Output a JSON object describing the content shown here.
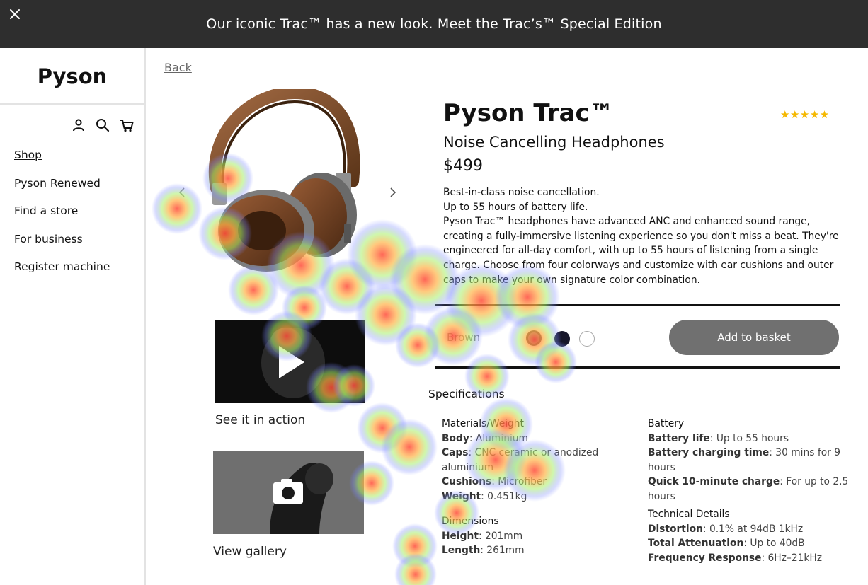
{
  "banner": {
    "close_icon": "close-icon",
    "text": "Our iconic Trac™ has a new look. Meet the Trac’s™ Special Edition"
  },
  "sidebar": {
    "brand": "Pyson",
    "icons": [
      "user-icon",
      "search-icon",
      "cart-icon"
    ],
    "nav": [
      {
        "label": "Shop"
      },
      {
        "label": "Pyson Renewed"
      },
      {
        "label": "Find a store"
      },
      {
        "label": "For business"
      },
      {
        "label": "Register machine"
      }
    ]
  },
  "main": {
    "back_label": "Back",
    "media": {
      "video_caption": "See it in action",
      "gallery_caption": "View gallery"
    }
  },
  "product": {
    "name": "Pyson Trac™",
    "rating_stars": "★★★★★",
    "subtitle": "Noise Cancelling Headphones",
    "price": "$499",
    "description": [
      "Best-in-class noise cancellation.",
      "Up to 55 hours of battery life.",
      "Pyson Trac™ headphones have advanced ANC and enhanced sound range, creating a fully-immersive listening experience so you don't miss a beat. They're engineered for all-day comfort, with up to 55 hours of listening from a single charge. Choose from four colorways and customize with ear cushions and outer caps to make your own signature color combination."
    ],
    "selected_color": "Brown",
    "swatches": [
      {
        "color": "#8a8a8a"
      },
      {
        "color": "#16162a"
      },
      {
        "color": "#ffffff"
      }
    ],
    "add_to_basket": "Add to basket"
  },
  "specs": {
    "heading": "Specifications",
    "materials": {
      "title": "Materials/Weight",
      "rows": [
        {
          "k": "Body",
          "v": ": Aluminium"
        },
        {
          "k": "Caps",
          "v": ": CNC ceramic or anodized aluminium"
        },
        {
          "k": "Cushions",
          "v": ": Microfiber"
        },
        {
          "k": "Weight",
          "v": ": 0.451kg"
        }
      ]
    },
    "dimensions": {
      "title": "Dimensions",
      "rows": [
        {
          "k": "Height",
          "v": ": 201mm"
        },
        {
          "k": "Length",
          "v": ": 261mm"
        }
      ]
    },
    "battery": {
      "title": "Battery",
      "rows": [
        {
          "k": "Battery life",
          "v": ": Up to 55 hours"
        },
        {
          "k": "Battery charging time",
          "v": ": 30 mins for 9 hours"
        },
        {
          "k": "Quick 10-minute charge",
          "v": ": For up to 2.5 hours"
        }
      ]
    },
    "technical": {
      "title": "Technical Details",
      "rows": [
        {
          "k": "Distortion",
          "v": ": 0.1% at 94dB 1kHz"
        },
        {
          "k": "Total Attenuation",
          "v": ": Up to 40dB"
        },
        {
          "k": "Frequency Response",
          "v": ": 6Hz–21kHz"
        }
      ]
    }
  },
  "colors": {
    "banner_bg": "#2e2e2e",
    "button_bg": "#707070",
    "star": "#f5b800"
  }
}
